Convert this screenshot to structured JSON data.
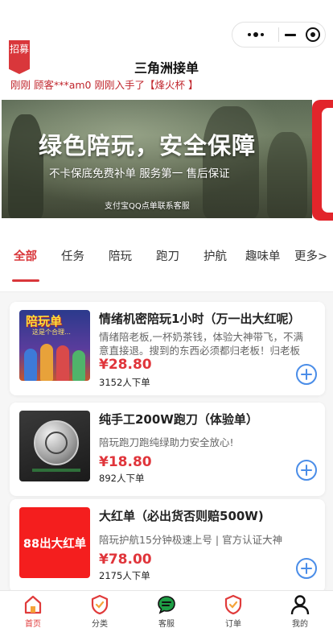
{
  "header": {
    "title": "三角洲接单",
    "recruit_tag": "招募",
    "ticker": "刚刚 顾客***am0 刚刚入手了【烽火杯 】"
  },
  "capsule": {
    "more_icon": "more-dots-icon",
    "minimize_icon": "minimize-icon",
    "close_icon": "close-target-icon"
  },
  "banner": {
    "headline": "绿色陪玩，安全保障",
    "subline": "不卡保底免费补单    服务第一    售后保证",
    "footline": "支付宝QQ点单联系客服"
  },
  "tabs": [
    {
      "label": "全部"
    },
    {
      "label": "任务"
    },
    {
      "label": "陪玩"
    },
    {
      "label": "跑刀"
    },
    {
      "label": "护航"
    },
    {
      "label": "趣味单"
    },
    {
      "label": "更多>"
    }
  ],
  "products": [
    {
      "thumb_title": "陪玩单",
      "thumb_sub": "这是个合理…",
      "title": "情绪机密陪玩1小时（万一出大红呢）",
      "desc": "情绪陪老板,一杯奶茶钱，体验大神带飞，不满意直接退。搜到的东西必须都归老板！归老板",
      "price": "¥28.80",
      "sales": "3152人下单"
    },
    {
      "title": "纯手工200W跑刀（体验单）",
      "desc": "陪玩跑刀跑纯绿助力安全放心!",
      "price": "¥18.80",
      "sales": "892人下单"
    },
    {
      "thumb_text": "88出大红单",
      "title": "大红单（必出货否则赔500W)",
      "desc": "陪玩护航15分钟极速上号 | 官方认证大神",
      "price": "¥78.00",
      "sales": "2175人下单"
    }
  ],
  "tabbar": [
    {
      "label": "首页",
      "icon": "home-icon"
    },
    {
      "label": "分类",
      "icon": "category-shield-icon"
    },
    {
      "label": "客服",
      "icon": "chat-icon"
    },
    {
      "label": "订单",
      "icon": "order-shield-icon"
    },
    {
      "label": "我的",
      "icon": "user-icon"
    }
  ],
  "colors": {
    "accent": "#d9373b",
    "price": "#e0353b",
    "add_button": "#4a8de8"
  }
}
